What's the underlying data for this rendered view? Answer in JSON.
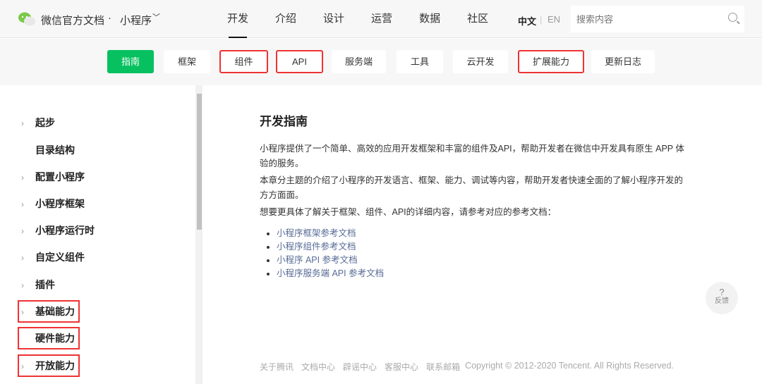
{
  "header": {
    "brand": "微信官方文档",
    "separator": "·",
    "product": "小程序",
    "nav": [
      "开发",
      "介绍",
      "设计",
      "运营",
      "数据",
      "社区"
    ],
    "lang_active": "中文",
    "lang_other": "EN",
    "search_placeholder": "搜索内容"
  },
  "subnav": [
    "指南",
    "框架",
    "组件",
    "API",
    "服务端",
    "工具",
    "云开发",
    "扩展能力",
    "更新日志"
  ],
  "sidebar": [
    "起步",
    "目录结构",
    "配置小程序",
    "小程序框架",
    "小程序运行时",
    "自定义组件",
    "插件",
    "基础能力",
    "硬件能力",
    "开放能力"
  ],
  "content": {
    "title": "开发指南",
    "p1": "小程序提供了一个简单、高效的应用开发框架和丰富的组件及API，帮助开发者在微信中开发具有原生 APP 体验的服务。",
    "p2": "本章分主题的介绍了小程序的开发语言、框架、能力、调试等内容，帮助开发者快速全面的了解小程序开发的方方面面。",
    "p3": "想要更具体了解关于框架、组件、API的详细内容，请参考对应的参考文档：",
    "links": [
      "小程序框架参考文档",
      "小程序组件参考文档",
      "小程序 API 参考文档",
      "小程序服务端 API 参考文档"
    ]
  },
  "feedback": {
    "icon": "?",
    "label": "反馈"
  },
  "footer": {
    "links": [
      "关于腾讯",
      "文档中心",
      "辟谣中心",
      "客服中心",
      "联系邮箱"
    ],
    "copyright": "Copyright © 2012-2020 Tencent. All Rights Reserved."
  },
  "colors": {
    "accent": "#07c160",
    "highlight": "#ee3333",
    "link": "#576b95"
  }
}
